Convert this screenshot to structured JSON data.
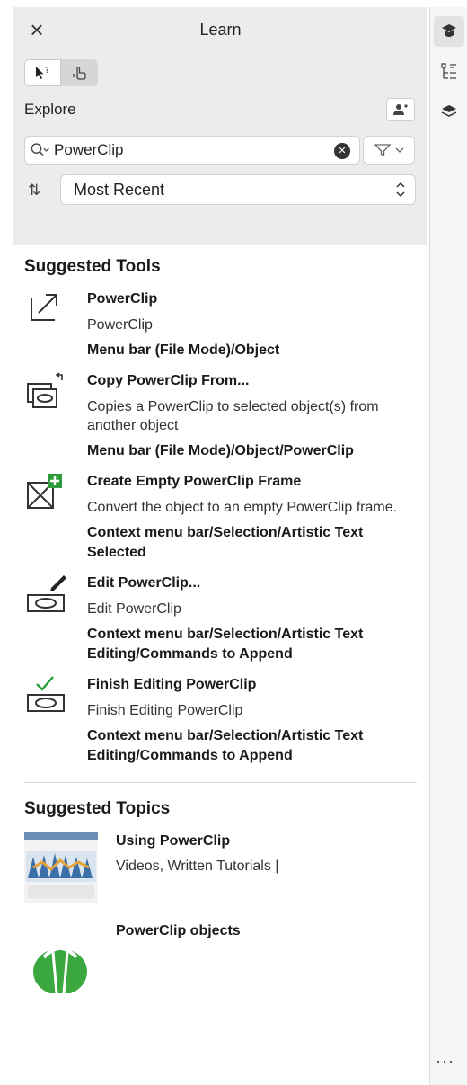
{
  "panel": {
    "title": "Learn",
    "close_glyph": "×"
  },
  "mode_toggle": {
    "buttons": [
      {
        "name": "whats-this-icon",
        "glyph": "↖?"
      },
      {
        "name": "hand-icon",
        "glyph": "☝"
      }
    ]
  },
  "explore": {
    "label": "Explore",
    "profile_glyph": "👤"
  },
  "search": {
    "value": "PowerClip",
    "placeholder": "",
    "search_glyph": "🔍︎",
    "clear_glyph": "✕",
    "filter_glyph": "▽",
    "filter_chevron": "⌄"
  },
  "sort": {
    "icon_glyph": "⇅",
    "selected": "Most Recent",
    "chevron": "⌃⌄"
  },
  "suggested_tools": {
    "title": "Suggested Tools",
    "items": [
      {
        "icon": "powerclip-icon",
        "name": "PowerClip",
        "desc": "PowerClip",
        "path": "Menu bar (File Mode)/Object"
      },
      {
        "icon": "copy-powerclip-icon",
        "name": "Copy PowerClip From...",
        "desc": "Copies a PowerClip to selected object(s) from another object",
        "path": "Menu bar (File Mode)/Object/PowerClip"
      },
      {
        "icon": "empty-frame-icon",
        "name": "Create Empty PowerClip Frame",
        "desc": "Convert the object to an empty PowerClip frame.",
        "path": "Context menu bar/Selection/Artistic Text Selected"
      },
      {
        "icon": "edit-powerclip-icon",
        "name": "Edit PowerClip...",
        "desc": "Edit PowerClip",
        "path": "Context menu bar/Selection/Artistic Text Editing/Commands to Append"
      },
      {
        "icon": "finish-powerclip-icon",
        "name": "Finish Editing PowerClip",
        "desc": "Finish Editing PowerClip",
        "path": "Context menu bar/Selection/Artistic Text Editing/Commands to Append"
      }
    ]
  },
  "suggested_topics": {
    "title": "Suggested Topics",
    "items": [
      {
        "name": "Using PowerClip",
        "meta": "Videos, Written Tutorials |"
      },
      {
        "name": "PowerClip objects",
        "meta": ""
      }
    ]
  },
  "rail": {
    "items": [
      "learn-icon",
      "properties-icon",
      "objects-icon"
    ],
    "more_glyph": "···"
  },
  "colors": {
    "header_bg": "#ececec",
    "accent_green": "#2e9b3a"
  }
}
